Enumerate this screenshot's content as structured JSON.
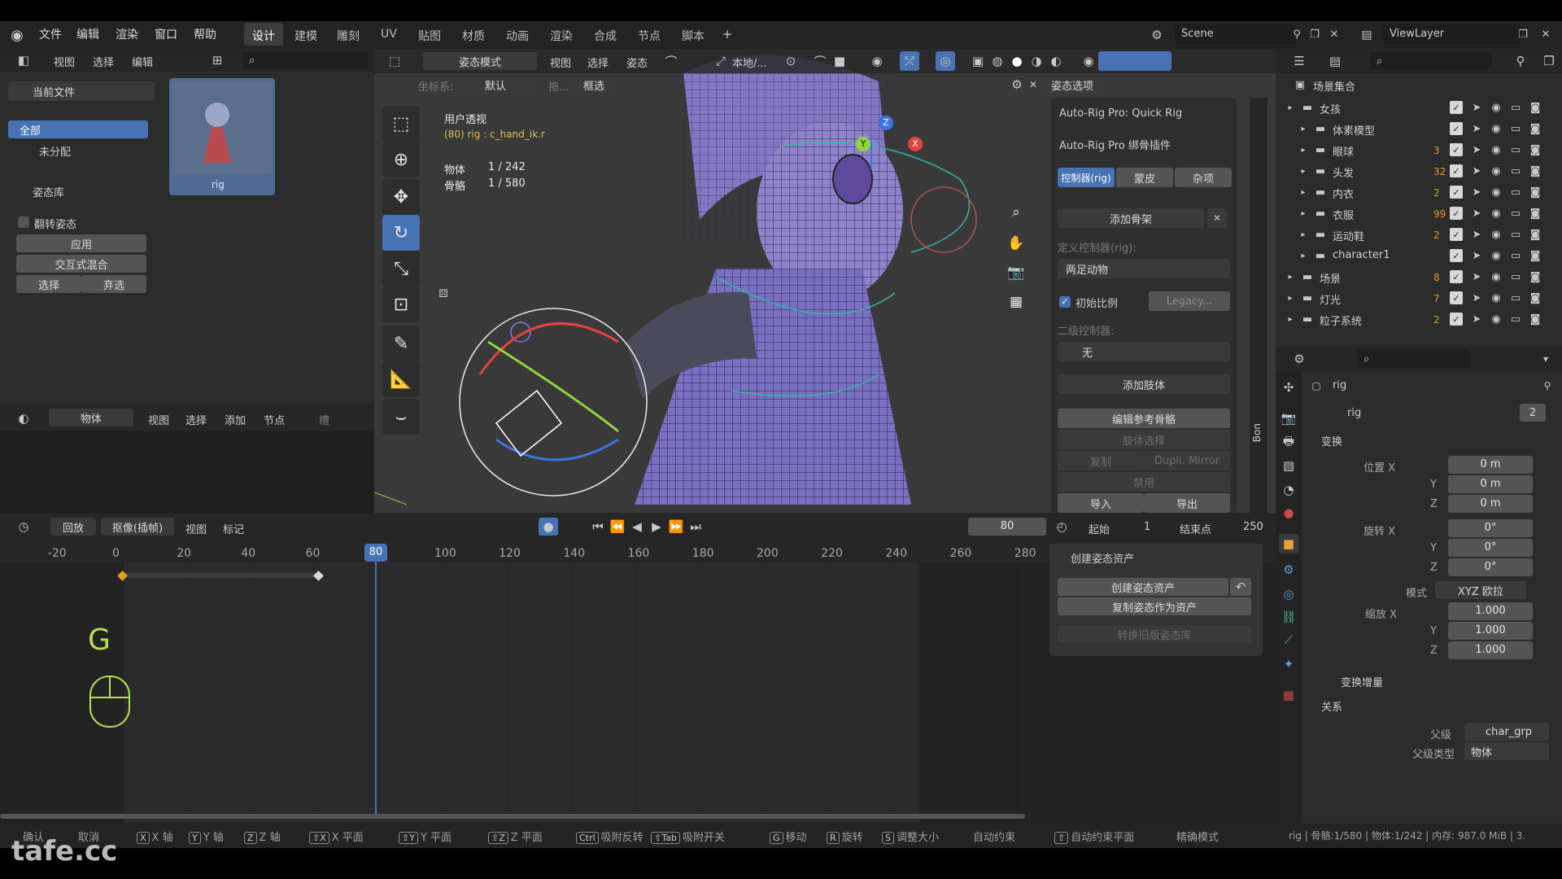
{
  "menu": [
    "文件",
    "编辑",
    "渲染",
    "窗口",
    "帮助"
  ],
  "workspaces": [
    "设计",
    "建模",
    "雕刻",
    "UV",
    "贴图",
    "材质",
    "动画",
    "渲染",
    "合成",
    "节点",
    "脚本"
  ],
  "active_workspace": "设计",
  "scene_name": "Scene",
  "viewlayer_name": "ViewLayer",
  "left": {
    "header_menu": [
      "视图",
      "选择",
      "编辑"
    ],
    "current_file": "当前文件",
    "all_label": "全部",
    "unassigned": "未分配",
    "asset_name": "rig",
    "pose_library": "姿态库",
    "flip_pose": "翻转姿态",
    "apply": "应用",
    "interactive_blend": "交互式混合",
    "select": "选择",
    "deselect": "弃选",
    "node_header": [
      "视图",
      "选择",
      "添加",
      "节点"
    ],
    "node_mode": "物体",
    "node_dim": "槽"
  },
  "viewport": {
    "mode": "姿态模式",
    "header_menu": [
      "视图",
      "选择",
      "姿态"
    ],
    "transform_orientation": "本地/...",
    "coord_label": "坐标系:",
    "coord_value": "默认",
    "drag_label": "拖...",
    "select_box": "框选",
    "pose_options": "姿态选项",
    "view_name": "用户透视",
    "rig_info": "(80) rig : c_hand_ik.r",
    "stat_obj_label": "物体",
    "stat_obj_value": "1 / 242",
    "stat_bone_label": "骨骼",
    "stat_bone_value": "1 / 580",
    "gizmo_x": "X",
    "gizmo_y": "Y",
    "gizmo_z": "Z"
  },
  "autorig": {
    "quick_rig": "Auto-Rig Pro: Quick Rig",
    "title": "Auto-Rig Pro 绑骨插件",
    "tabs": [
      "控制器(rig)",
      "蒙皮",
      "杂项"
    ],
    "add_armature": "添加骨架",
    "define_ctrl_label": "定义控制器(rig):",
    "define_ctrl_value": "两足动物",
    "init_scale": "初始比例",
    "legacy": "Legacy...",
    "secondary_label": "二级控制器:",
    "secondary_value": "无",
    "add_limb": "添加肢体",
    "edit_ref": "编辑参考骨骼",
    "limb_select": "肢体选择",
    "duplicate": "复制",
    "dupli_mirror": "Dupli. Mirror",
    "disable": "禁用",
    "import": "导入",
    "export": "导出",
    "side_tab": "Bon"
  },
  "outliner": {
    "root": "场景集合",
    "items": [
      {
        "name": "女孩",
        "indent": 0,
        "badge": ""
      },
      {
        "name": "体素模型",
        "indent": 1,
        "badge": ""
      },
      {
        "name": "眼球",
        "indent": 1,
        "badge": "3"
      },
      {
        "name": "头发",
        "indent": 1,
        "badge": "32"
      },
      {
        "name": "内衣",
        "indent": 1,
        "badge": "2"
      },
      {
        "name": "衣服",
        "indent": 1,
        "badge": "99"
      },
      {
        "name": "运动鞋",
        "indent": 1,
        "badge": "2"
      },
      {
        "name": "character1",
        "indent": 1,
        "badge": ""
      },
      {
        "name": "场景",
        "indent": 0,
        "badge": "8"
      },
      {
        "name": "灯光",
        "indent": 0,
        "badge": "7"
      },
      {
        "name": "粒子系统",
        "indent": 0,
        "badge": "2"
      }
    ]
  },
  "properties": {
    "object_name": "rig",
    "data_name": "rig",
    "users": "2",
    "transform": "变换",
    "location_label": "位置 X",
    "loc": [
      "0 m",
      "0 m",
      "0 m"
    ],
    "rotation_label": "旋转 X",
    "rot": [
      "0°",
      "0°",
      "0°"
    ],
    "mode_label": "模式",
    "mode_value": "XYZ 欧拉",
    "scale_label": "缩放 X",
    "scale": [
      "1.000",
      "1.000",
      "1.000"
    ],
    "y": "Y",
    "z": "Z",
    "delta": "变换增量",
    "relations": "关系",
    "parent_label": "父级",
    "parent_value": "char_grp",
    "parent_type_label": "父级类型",
    "parent_type_value": "物体"
  },
  "timeline": {
    "playback": "回放",
    "keying": "抠像(插帧)",
    "view": "视图",
    "marker": "标记",
    "current_frame": "80",
    "start_label": "起始",
    "start": "1",
    "end_label": "结束点",
    "end": "250",
    "ticks": [
      "-20",
      "0",
      "20",
      "40",
      "60",
      "80",
      "100",
      "120",
      "140",
      "160",
      "180",
      "200",
      "220",
      "240",
      "260",
      "280"
    ],
    "overlay_key": "G"
  },
  "pose_asset": {
    "title": "创建姿态资产",
    "create": "创建姿态资产",
    "copy": "复制姿态作为资产",
    "convert": "转换旧版姿态库"
  },
  "status": {
    "items": [
      "确认",
      "取消",
      "X 轴",
      "Y 轴",
      "Z 轴",
      "X 平面",
      "Y 平面",
      "Z 平面",
      "吸附反转",
      "吸附开关",
      "移动",
      "旋转",
      "调整大小",
      "自动约束",
      "自动约束平面",
      "精确模式"
    ],
    "keys": [
      "",
      "",
      "X",
      "Y",
      "Z",
      "⇧X",
      "⇧Y",
      "⇧Z",
      "Ctrl",
      "⇧Tab",
      "G",
      "R",
      "S",
      "",
      "⇧",
      ""
    ],
    "right": "rig | 骨骼:1/580 | 物体:1/242 | 内存: 987.0 MiB | 3.",
    "watermark": "tafe.cc"
  }
}
